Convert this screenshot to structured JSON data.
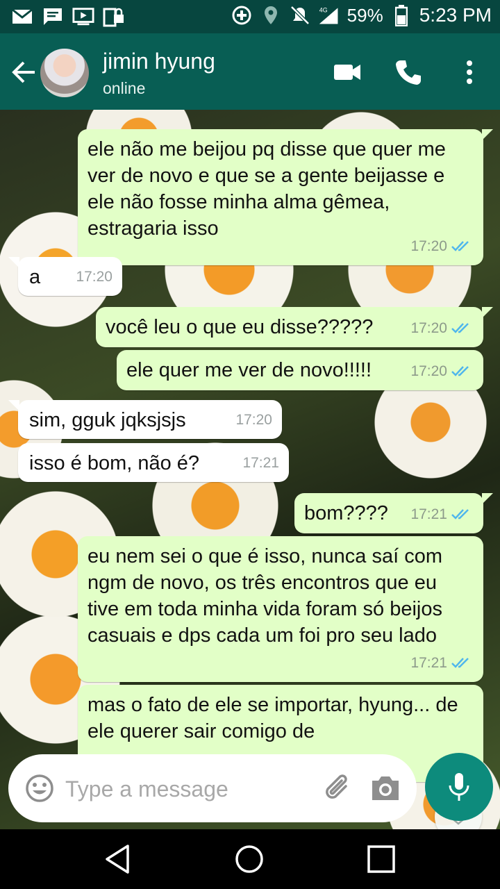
{
  "status_bar": {
    "battery": "59%",
    "time": "5:23 PM",
    "network": "4G",
    "left_icons": [
      "mail-icon",
      "message-icon",
      "media-icon",
      "sim-lock-icon"
    ],
    "right_icons": [
      "data-saver-icon",
      "location-icon",
      "mute-icon",
      "signal-icon",
      "battery-icon"
    ]
  },
  "header": {
    "contact_name": "jimin hyung",
    "status": "online"
  },
  "messages": [
    {
      "dir": "out",
      "text": "ele não me beijou pq disse que quer me ver de novo e que se a gente beijasse e ele não fosse minha alma gêmea, estragaria isso",
      "time": "17:20"
    },
    {
      "dir": "in",
      "text": "a",
      "time": "17:20"
    },
    {
      "dir": "out",
      "text": "você leu o que eu disse?????",
      "time": "17:20"
    },
    {
      "dir": "out",
      "text": "ele quer me ver de novo!!!!!",
      "time": "17:20"
    },
    {
      "dir": "in",
      "text": "sim, gguk jqksjsjs",
      "time": "17:20"
    },
    {
      "dir": "in",
      "text": "isso é bom, não é?",
      "time": "17:21"
    },
    {
      "dir": "out",
      "text": "bom????",
      "time": "17:21"
    },
    {
      "dir": "out",
      "text": "eu nem sei o que é isso, nunca saí com ngm de novo, os três encontros que eu tive em toda minha vida foram só beijos casuais e dps cada um foi pro seu lado",
      "time": "17:21"
    },
    {
      "dir": "out",
      "text": "mas o fato de ele se importar, hyung... de ele querer sair comigo de",
      "time": ""
    }
  ],
  "input": {
    "placeholder": "Type a message"
  },
  "colors": {
    "header": "#085e54",
    "status_bar": "#07463f",
    "outgoing_bubble": "#e2ffc7",
    "incoming_bubble": "#ffffff",
    "mic_button": "#0d8b7c",
    "read_ticks": "#4fb6ec"
  }
}
